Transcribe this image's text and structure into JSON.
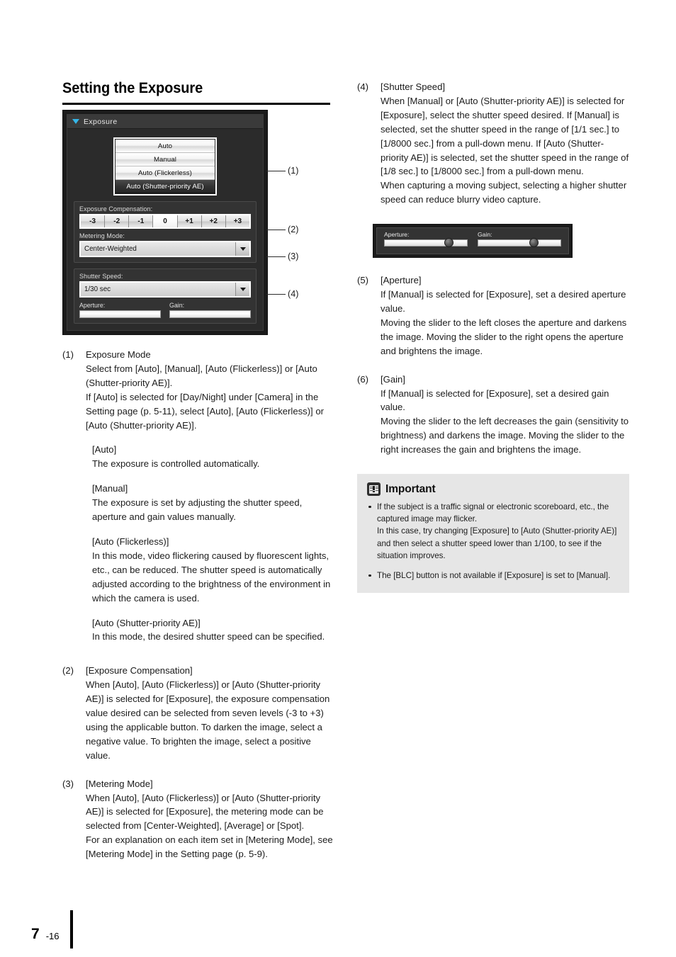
{
  "page": {
    "title": "Setting the Exposure",
    "footer_chapter": "7",
    "footer_page": "-16"
  },
  "screenshot_exposure": {
    "titlebar_label": "Exposure",
    "mode_items": [
      {
        "label": "Auto",
        "selected": false
      },
      {
        "label": "Manual",
        "selected": false
      },
      {
        "label": "Auto (Flickerless)",
        "selected": false
      },
      {
        "label": "Auto (Shutter-priority AE)",
        "selected": true
      }
    ],
    "exposure_compensation_label": "Exposure Compensation:",
    "exposure_compensation_values": [
      "-3",
      "-2",
      "-1",
      "0",
      "+1",
      "+2",
      "+3"
    ],
    "exposure_compensation_selected": "0",
    "metering_mode_label": "Metering Mode:",
    "metering_mode_value": "Center-Weighted",
    "shutter_speed_label": "Shutter Speed:",
    "shutter_speed_value": "1/30 sec",
    "aperture_label": "Aperture:",
    "gain_label": "Gain:",
    "callouts": [
      "(1)",
      "(2)",
      "(3)",
      "(4)"
    ]
  },
  "screenshot_sliders": {
    "aperture_label": "Aperture:",
    "gain_label": "Gain:",
    "aperture_position_pct": 72,
    "gain_position_pct": 62
  },
  "left_column": {
    "item1": {
      "num": "(1)",
      "head": "Exposure Mode",
      "body": "Select from [Auto], [Manual], [Auto (Flickerless)] or [Auto (Shutter-priority AE)].\nIf [Auto] is selected for [Day/Night] under [Camera] in the Setting page (p. 5-11), select [Auto], [Auto (Flickerless)] or [Auto (Shutter-priority AE)].",
      "subs": [
        {
          "head": "[Auto]",
          "body": "The exposure is controlled automatically."
        },
        {
          "head": "[Manual]",
          "body": "The exposure is set by adjusting the shutter speed, aperture and gain values manually."
        },
        {
          "head": "[Auto (Flickerless)]",
          "body": "In this mode, video flickering caused by fluorescent lights, etc., can be reduced. The shutter speed is automatically adjusted according to the brightness of the environment in which the camera is used."
        },
        {
          "head": "[Auto (Shutter-priority AE)]",
          "body": "In this mode, the desired shutter speed can be specified."
        }
      ]
    },
    "item2": {
      "num": "(2)",
      "head": "[Exposure Compensation]",
      "body": "When [Auto], [Auto (Flickerless)] or [Auto (Shutter-priority AE)] is selected for [Exposure], the exposure compensation value desired can be selected from seven levels (-3 to +3) using the applicable button. To darken the image, select a negative value. To brighten the image, select a positive value."
    },
    "item3": {
      "num": "(3)",
      "head": "[Metering Mode]",
      "body": "When [Auto], [Auto (Flickerless)] or [Auto (Shutter-priority AE)] is selected for [Exposure], the metering mode can be selected from [Center-Weighted], [Average] or [Spot].\nFor an explanation on each item set in [Metering Mode], see [Metering Mode] in the Setting page (p. 5-9)."
    }
  },
  "right_column": {
    "item4": {
      "num": "(4)",
      "head": "[Shutter Speed]",
      "body": "When [Manual] or [Auto (Shutter-priority AE)] is selected for [Exposure], select the shutter speed desired. If [Manual] is selected, set the shutter speed in the range of [1/1 sec.] to [1/8000 sec.] from a pull-down menu. If [Auto (Shutter-priority AE)] is selected, set the shutter speed in the range of [1/8 sec.] to [1/8000 sec.] from a pull-down menu.\nWhen capturing a moving subject, selecting a higher shutter speed can reduce blurry video capture."
    },
    "item5": {
      "num": "(5)",
      "head": "[Aperture]",
      "body": "If [Manual] is selected for [Exposure], set a desired aperture value.\nMoving the slider to the left closes the aperture and darkens the image. Moving the slider to the right opens the aperture and brightens the image."
    },
    "item6": {
      "num": "(6)",
      "head": "[Gain]",
      "body": "If [Manual] is selected for [Exposure], set a desired gain value.\nMoving the slider to the left decreases the gain (sensitivity to brightness) and darkens the image. Moving the slider to the right increases the gain and brightens the image."
    },
    "important": {
      "title": "Important",
      "bullets": [
        "If the subject is a traffic signal or electronic scoreboard, etc., the captured image may flicker.\nIn this case, try changing [Exposure] to [Auto (Shutter-priority AE)] and then select a shutter speed lower than 1/100, to see if the situation improves.",
        "The [BLC] button is not available if [Exposure] is set to [Manual]."
      ]
    }
  }
}
